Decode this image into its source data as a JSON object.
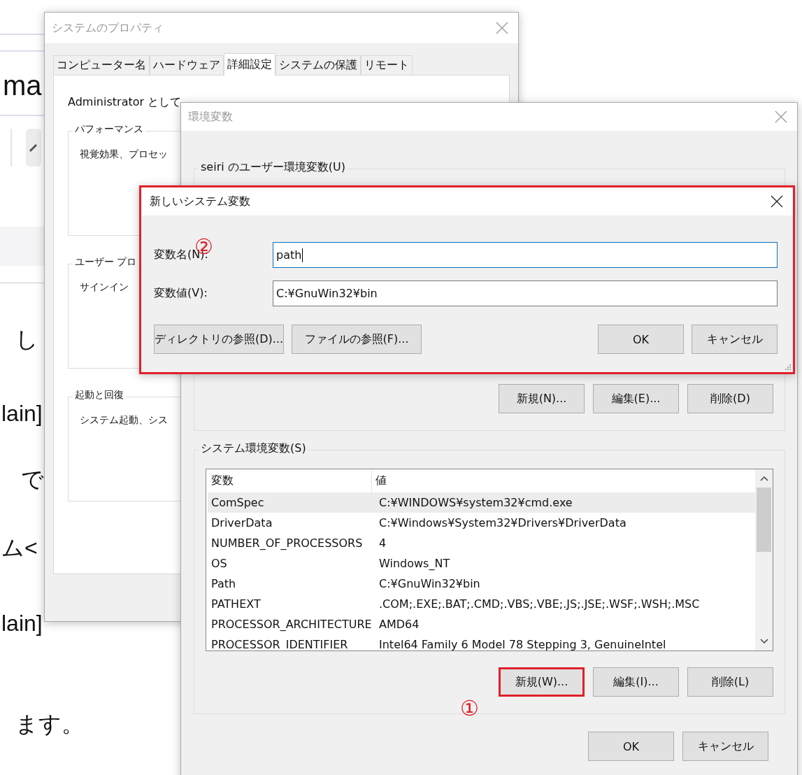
{
  "background_page": {
    "lines": [
      "ma",
      "し",
      "lain]",
      "で",
      "ム<",
      "lain]",
      "ます。"
    ]
  },
  "system_properties": {
    "title": "システムのプロパティ",
    "tabs": [
      {
        "label": "コンピューター名",
        "selected": false
      },
      {
        "label": "ハードウェア",
        "selected": false
      },
      {
        "label": "詳細設定",
        "selected": true
      },
      {
        "label": "システムの保護",
        "selected": false
      },
      {
        "label": "リモート",
        "selected": false
      }
    ],
    "notice": "Administrator として",
    "groups": [
      {
        "label": "パフォーマンス",
        "text": "視覚効果、プロセッ"
      },
      {
        "label": "ユーザー プロ",
        "text": "サインイン"
      },
      {
        "label": "起動と回復",
        "text": "システム起動、シス"
      }
    ]
  },
  "environment_variables": {
    "title": "環境変数",
    "user_group": {
      "label": "seiri のユーザー環境変数(U)",
      "buttons": [
        "新規(N)...",
        "編集(E)...",
        "削除(D)"
      ]
    },
    "system_group": {
      "label": "システム環境変数(S)",
      "columns": [
        "変数",
        "値"
      ],
      "rows": [
        {
          "name": "ComSpec",
          "value": "C:¥WINDOWS¥system32¥cmd.exe",
          "selected": true
        },
        {
          "name": "DriverData",
          "value": "C:¥Windows¥System32¥Drivers¥DriverData",
          "selected": false
        },
        {
          "name": "NUMBER_OF_PROCESSORS",
          "value": "4",
          "selected": false
        },
        {
          "name": "OS",
          "value": "Windows_NT",
          "selected": false
        },
        {
          "name": "Path",
          "value": "C:¥GnuWin32¥bin",
          "selected": false
        },
        {
          "name": "PATHEXT",
          "value": ".COM;.EXE;.BAT;.CMD;.VBS;.VBE;.JS;.JSE;.WSF;.WSH;.MSC",
          "selected": false
        },
        {
          "name": "PROCESSOR_ARCHITECTURE",
          "value": "AMD64",
          "selected": false
        },
        {
          "name": "PROCESSOR_IDENTIFIER",
          "value": "Intel64 Family 6 Model 78 Stepping 3, GenuineIntel",
          "selected": false
        }
      ],
      "buttons": [
        {
          "label": "新規(W)...",
          "highlighted": true
        },
        {
          "label": "編集(I)...",
          "highlighted": false
        },
        {
          "label": "削除(L)",
          "highlighted": false
        }
      ],
      "step_mark": "①"
    },
    "buttons": [
      "OK",
      "キャンセル"
    ]
  },
  "new_system_variable": {
    "title": "新しいシステム変数",
    "highlighted": true,
    "step_mark": "②",
    "fields": [
      {
        "label": "変数名(N):",
        "value": "path",
        "focused": true
      },
      {
        "label": "変数値(V):",
        "value": "C:¥GnuWin32¥bin",
        "focused": false
      }
    ],
    "browse_buttons": [
      "ディレクトリの参照(D)...",
      "ファイルの参照(F)..."
    ],
    "buttons": [
      "OK",
      "キャンセル"
    ]
  }
}
